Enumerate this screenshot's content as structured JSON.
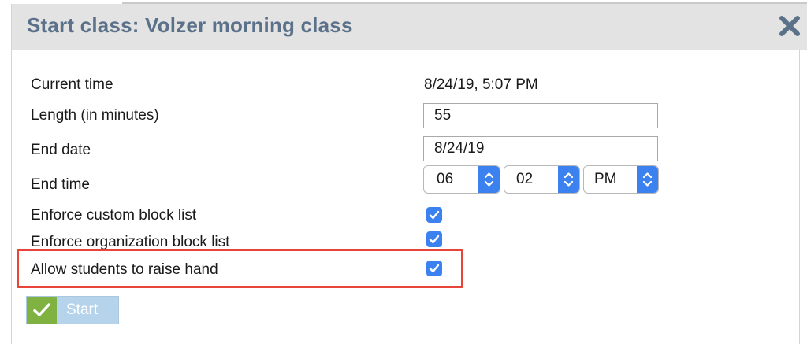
{
  "dialog": {
    "title": "Start class: Volzer morning class"
  },
  "form": {
    "current_time": {
      "label": "Current time",
      "value": "8/24/19, 5:07 PM"
    },
    "length": {
      "label": "Length (in minutes)",
      "value": "55"
    },
    "end_date": {
      "label": "End date",
      "value": "8/24/19"
    },
    "end_time": {
      "label": "End time",
      "hour": "06",
      "minute": "02",
      "ampm": "PM"
    },
    "enforce_custom_block_list": {
      "label": "Enforce custom block list",
      "checked": true
    },
    "enforce_organization_block_list": {
      "label": "Enforce organization block list",
      "checked": true
    },
    "allow_raise_hand": {
      "label": "Allow students to raise hand",
      "checked": true
    }
  },
  "actions": {
    "start_label": "Start"
  },
  "icons": {
    "close": "close-icon",
    "start": "checkmark-icon",
    "select": "updown-chevron-icon",
    "checkbox": "checkmark-icon"
  },
  "colors": {
    "title": "#5b7189",
    "header_bg": "#e3e3e3",
    "accent_blue": "#3b82f0",
    "highlight_red": "#e8443a",
    "start_green": "#7fb241",
    "start_bg": "#b5d3ea"
  }
}
